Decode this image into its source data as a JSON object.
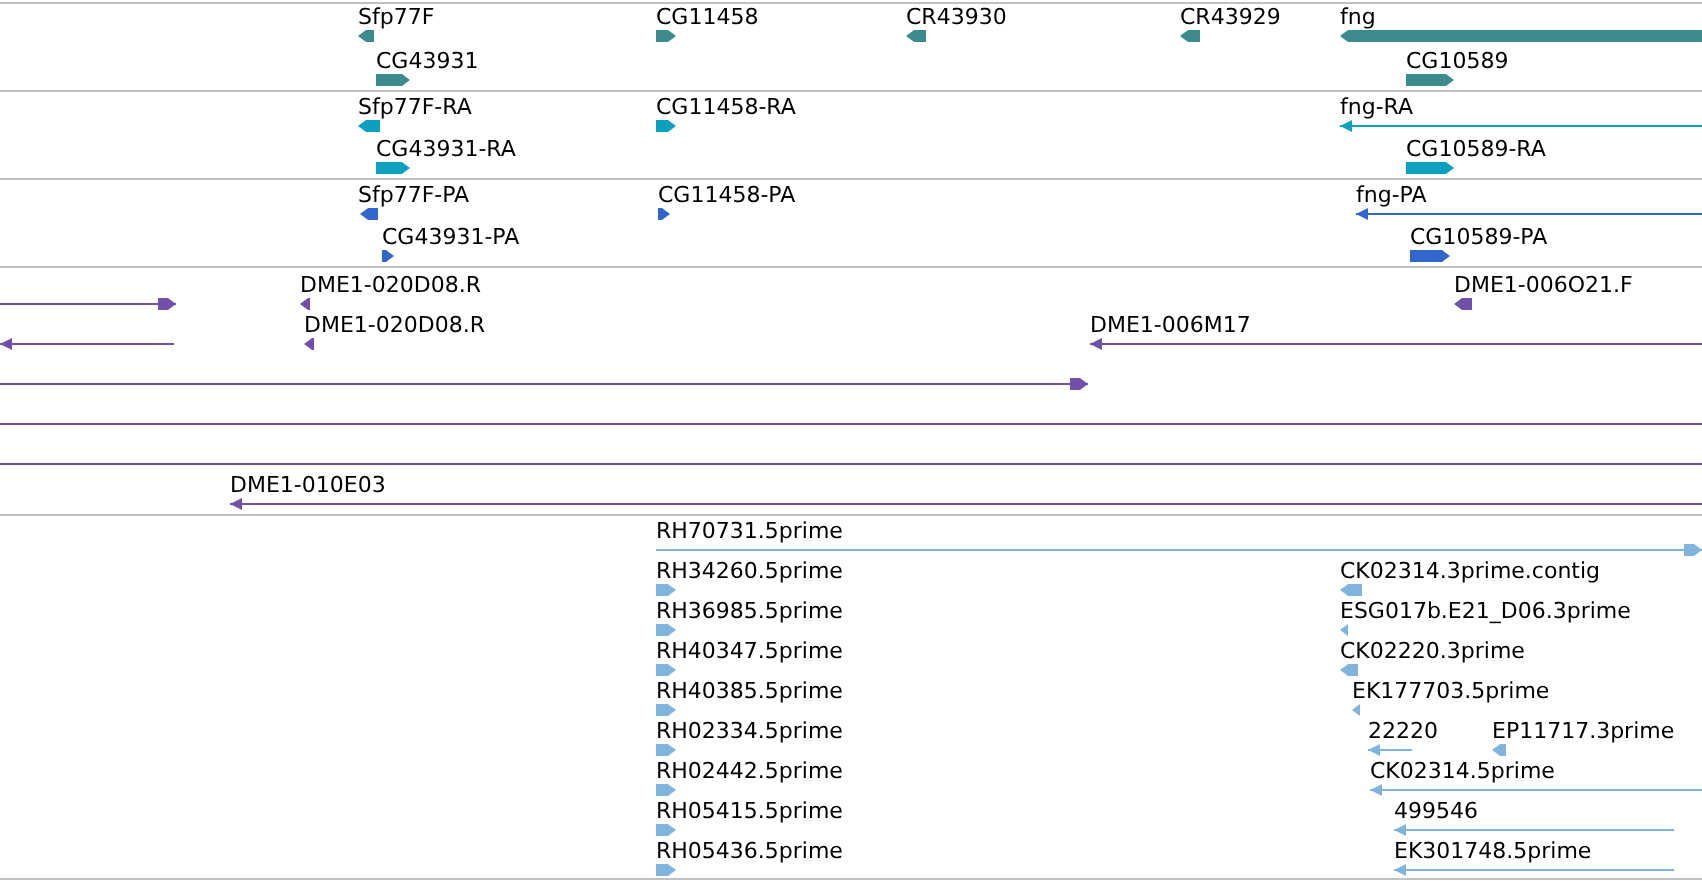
{
  "tracks": [
    {
      "color": "#3d8b8f",
      "features": [
        {
          "kind": "block",
          "label": "Sfp77F",
          "reverse": true
        },
        {
          "kind": "block",
          "label": "CG43931",
          "reverse": false
        },
        {
          "kind": "block",
          "label": "CG11458",
          "reverse": false
        },
        {
          "kind": "block",
          "label": "CR43930",
          "reverse": true
        },
        {
          "kind": "block",
          "label": "CR43929",
          "reverse": true
        },
        {
          "kind": "block",
          "label": "fng",
          "reverse": true
        },
        {
          "kind": "block",
          "label": "CG10589",
          "reverse": false
        }
      ]
    },
    {
      "color": "#0ca0c0",
      "features": [
        {
          "kind": "block",
          "label": "Sfp77F-RA",
          "reverse": true
        },
        {
          "kind": "block",
          "label": "CG43931-RA",
          "reverse": false
        },
        {
          "kind": "block",
          "label": "CG11458-RA",
          "reverse": false
        },
        {
          "kind": "line",
          "label": "fng-RA",
          "reverse": true
        },
        {
          "kind": "block",
          "label": "CG10589-RA",
          "reverse": false
        }
      ]
    },
    {
      "color": "#3366cc",
      "features": [
        {
          "kind": "block",
          "label": "Sfp77F-PA",
          "reverse": true
        },
        {
          "kind": "block",
          "label": "CG43931-PA",
          "reverse": false
        },
        {
          "kind": "block",
          "label": "CG11458-PA",
          "reverse": false
        },
        {
          "kind": "line",
          "label": "fng-PA",
          "reverse": true
        },
        {
          "kind": "block",
          "label": "CG10589-PA",
          "reverse": false
        }
      ]
    },
    {
      "color": "#7050a8",
      "features": [
        {
          "kind": "line",
          "reverse": false
        },
        {
          "kind": "block",
          "label": "DME1-020D08.R",
          "reverse": true
        },
        {
          "kind": "block",
          "label": "DME1-006O21.F",
          "reverse": true
        },
        {
          "kind": "line",
          "reverse": true
        },
        {
          "kind": "block",
          "label": "DME1-020D08.R",
          "reverse": true
        },
        {
          "kind": "line",
          "label": "DME1-006M17",
          "reverse": true
        },
        {
          "kind": "line",
          "reverse": false
        },
        {
          "kind": "connector"
        },
        {
          "kind": "connector"
        },
        {
          "kind": "line",
          "label": "DME1-010E03",
          "reverse": true
        }
      ]
    },
    {
      "color": "#80b4dc",
      "features": [
        {
          "kind": "line",
          "label": "RH70731.5prime",
          "reverse": false
        },
        {
          "kind": "block",
          "label": "RH34260.5prime",
          "reverse": false
        },
        {
          "kind": "block",
          "label": "RH36985.5prime",
          "reverse": false
        },
        {
          "kind": "block",
          "label": "RH40347.5prime",
          "reverse": false
        },
        {
          "kind": "block",
          "label": "RH40385.5prime",
          "reverse": false
        },
        {
          "kind": "block",
          "label": "RH02334.5prime",
          "reverse": false
        },
        {
          "kind": "block",
          "label": "RH02442.5prime",
          "reverse": false
        },
        {
          "kind": "block",
          "label": "RH05415.5prime",
          "reverse": false
        },
        {
          "kind": "block",
          "label": "RH05436.5prime",
          "reverse": false
        },
        {
          "kind": "block",
          "label": "CK02314.3prime.contig",
          "reverse": true
        },
        {
          "kind": "block",
          "label": "ESG017b.E21_D06.3prime",
          "reverse": true
        },
        {
          "kind": "block",
          "label": "CK02220.3prime",
          "reverse": true
        },
        {
          "kind": "block",
          "label": "EK177703.5prime",
          "reverse": true
        },
        {
          "kind": "line",
          "label": "22220",
          "reverse": true
        },
        {
          "kind": "block",
          "label": "EP11717.3prime",
          "reverse": true
        },
        {
          "kind": "line",
          "label": "CK02314.5prime",
          "reverse": true
        },
        {
          "kind": "line",
          "label": "499546",
          "reverse": true
        },
        {
          "kind": "line",
          "label": "EK301748.5prime",
          "reverse": true
        }
      ]
    }
  ]
}
